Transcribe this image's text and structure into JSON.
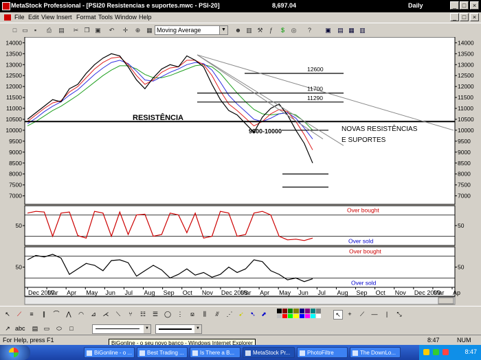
{
  "window": {
    "title": "MetaStock Professional - [PSI20  Resistencias e suportes.mwc - PSI-20]",
    "price": "8,697.04",
    "periodicity": "Daily",
    "controls": [
      "_",
      "□",
      "×"
    ]
  },
  "menu": [
    "File",
    "Edit",
    "View",
    "Insert",
    "Format",
    "Tools",
    "Window",
    "Help"
  ],
  "toolbar": {
    "indicator_select": "Moving Average"
  },
  "chart_data": [
    {
      "type": "line",
      "panel": "price",
      "y_ticks": [
        14000,
        13500,
        13000,
        12500,
        12000,
        11500,
        11000,
        10500,
        10000,
        9500,
        9000,
        8500,
        8000,
        7500,
        7000
      ],
      "ylim": [
        6800,
        14200
      ],
      "x_ticks": [
        "Dec 2007",
        "Mar",
        "Apr",
        "May",
        "Jun",
        "Jul",
        "Aug",
        "Sep",
        "Oct",
        "Nov",
        "Dec 2008",
        "Mar",
        "Apr",
        "May",
        "Jun",
        "Jul",
        "Aug",
        "Sep",
        "Oct",
        "Nov",
        "Dec 2009",
        "Mar",
        "Ap"
      ],
      "series": [
        {
          "values": [
            10500,
            10800,
            11100,
            11400,
            11300,
            11900,
            12100,
            12600,
            13000,
            13300,
            13500,
            13400,
            12900,
            12300,
            11900,
            12400,
            12800,
            13000,
            12900,
            13400,
            13200,
            12900,
            12100,
            11400,
            10900,
            10700,
            10300,
            9900,
            10600,
            11000,
            11200,
            10700,
            10000,
            9400,
            8500
          ],
          "color": "#000000"
        },
        {
          "values": [
            10400,
            10700,
            11000,
            11250,
            11350,
            11750,
            12000,
            12400,
            12800,
            13100,
            13300,
            13350,
            13000,
            12500,
            12100,
            12300,
            12650,
            12850,
            12900,
            13200,
            13200,
            13000,
            12500,
            11800,
            11200,
            10900,
            10550,
            10200,
            10400,
            10750,
            10950,
            10850,
            10400,
            9800,
            9100
          ],
          "color": "#e02020"
        },
        {
          "values": [
            10300,
            10550,
            10850,
            11100,
            11300,
            11600,
            11850,
            12200,
            12550,
            12850,
            13100,
            13200,
            13050,
            12700,
            12300,
            12250,
            12450,
            12650,
            12800,
            13000,
            13100,
            13050,
            12750,
            12200,
            11600,
            11200,
            10850,
            10500,
            10400,
            10550,
            10750,
            10800,
            10550,
            10100,
            9600
          ],
          "color": "#3030e0"
        },
        {
          "values": [
            10200,
            10400,
            10650,
            10900,
            11100,
            11350,
            11600,
            11900,
            12200,
            12500,
            12750,
            12950,
            12950,
            12800,
            12550,
            12400,
            12400,
            12500,
            12650,
            12800,
            12950,
            13000,
            12900,
            12600,
            12150,
            11700,
            11300,
            10950,
            10750,
            10700,
            10750,
            10800,
            10700,
            10400,
            10000
          ],
          "color": "#20a020"
        }
      ],
      "levels": [
        12600,
        11700,
        11290,
        10400,
        10000,
        8000,
        7400
      ],
      "annotations": [
        "12600",
        "11700",
        "11290",
        "RESISTÊNCIA",
        "9800-10000",
        "NOVAS RESISTÊNCIAS",
        "E SUPORTES"
      ]
    },
    {
      "type": "line",
      "panel": "oscillator-1",
      "y_ticks": [
        50
      ],
      "ylim": [
        0,
        100
      ],
      "levels": [
        80,
        20
      ],
      "series": [
        {
          "values": [
            85,
            90,
            88,
            20,
            85,
            88,
            22,
            15,
            90,
            85,
            20,
            88,
            25,
            80,
            82,
            20,
            25,
            85,
            80,
            30,
            85,
            15,
            20,
            90,
            85,
            20,
            25,
            85,
            90,
            80,
            20,
            10,
            12,
            8,
            15
          ],
          "color": "#cc0000"
        }
      ],
      "annotations": [
        "Over bought",
        "Over sold"
      ]
    },
    {
      "type": "line",
      "panel": "oscillator-2",
      "y_ticks": [
        50
      ],
      "ylim": [
        0,
        100
      ],
      "levels": [
        80,
        20
      ],
      "series": [
        {
          "values": [
            70,
            82,
            78,
            85,
            75,
            30,
            45,
            60,
            55,
            40,
            68,
            70,
            62,
            25,
            40,
            55,
            42,
            20,
            30,
            45,
            28,
            35,
            22,
            30,
            50,
            35,
            45,
            70,
            65,
            40,
            30,
            15,
            20,
            10,
            18
          ],
          "color": "#000000"
        }
      ],
      "annotations": [
        "Over bought",
        "Over sold"
      ]
    }
  ],
  "status": {
    "help": "For Help, press F1",
    "time": "8:47",
    "num": "NUM"
  },
  "tooltip": "BiGonline - o seu novo banco - Windows Internet Explorer",
  "taskbar": {
    "tasks": [
      "BiGonline - o ...",
      "Best Trading ...",
      "Is There a B...",
      "MetaStock Pr...",
      "PhotoFiltre",
      "The DownLo..."
    ],
    "clock": "8:47"
  }
}
